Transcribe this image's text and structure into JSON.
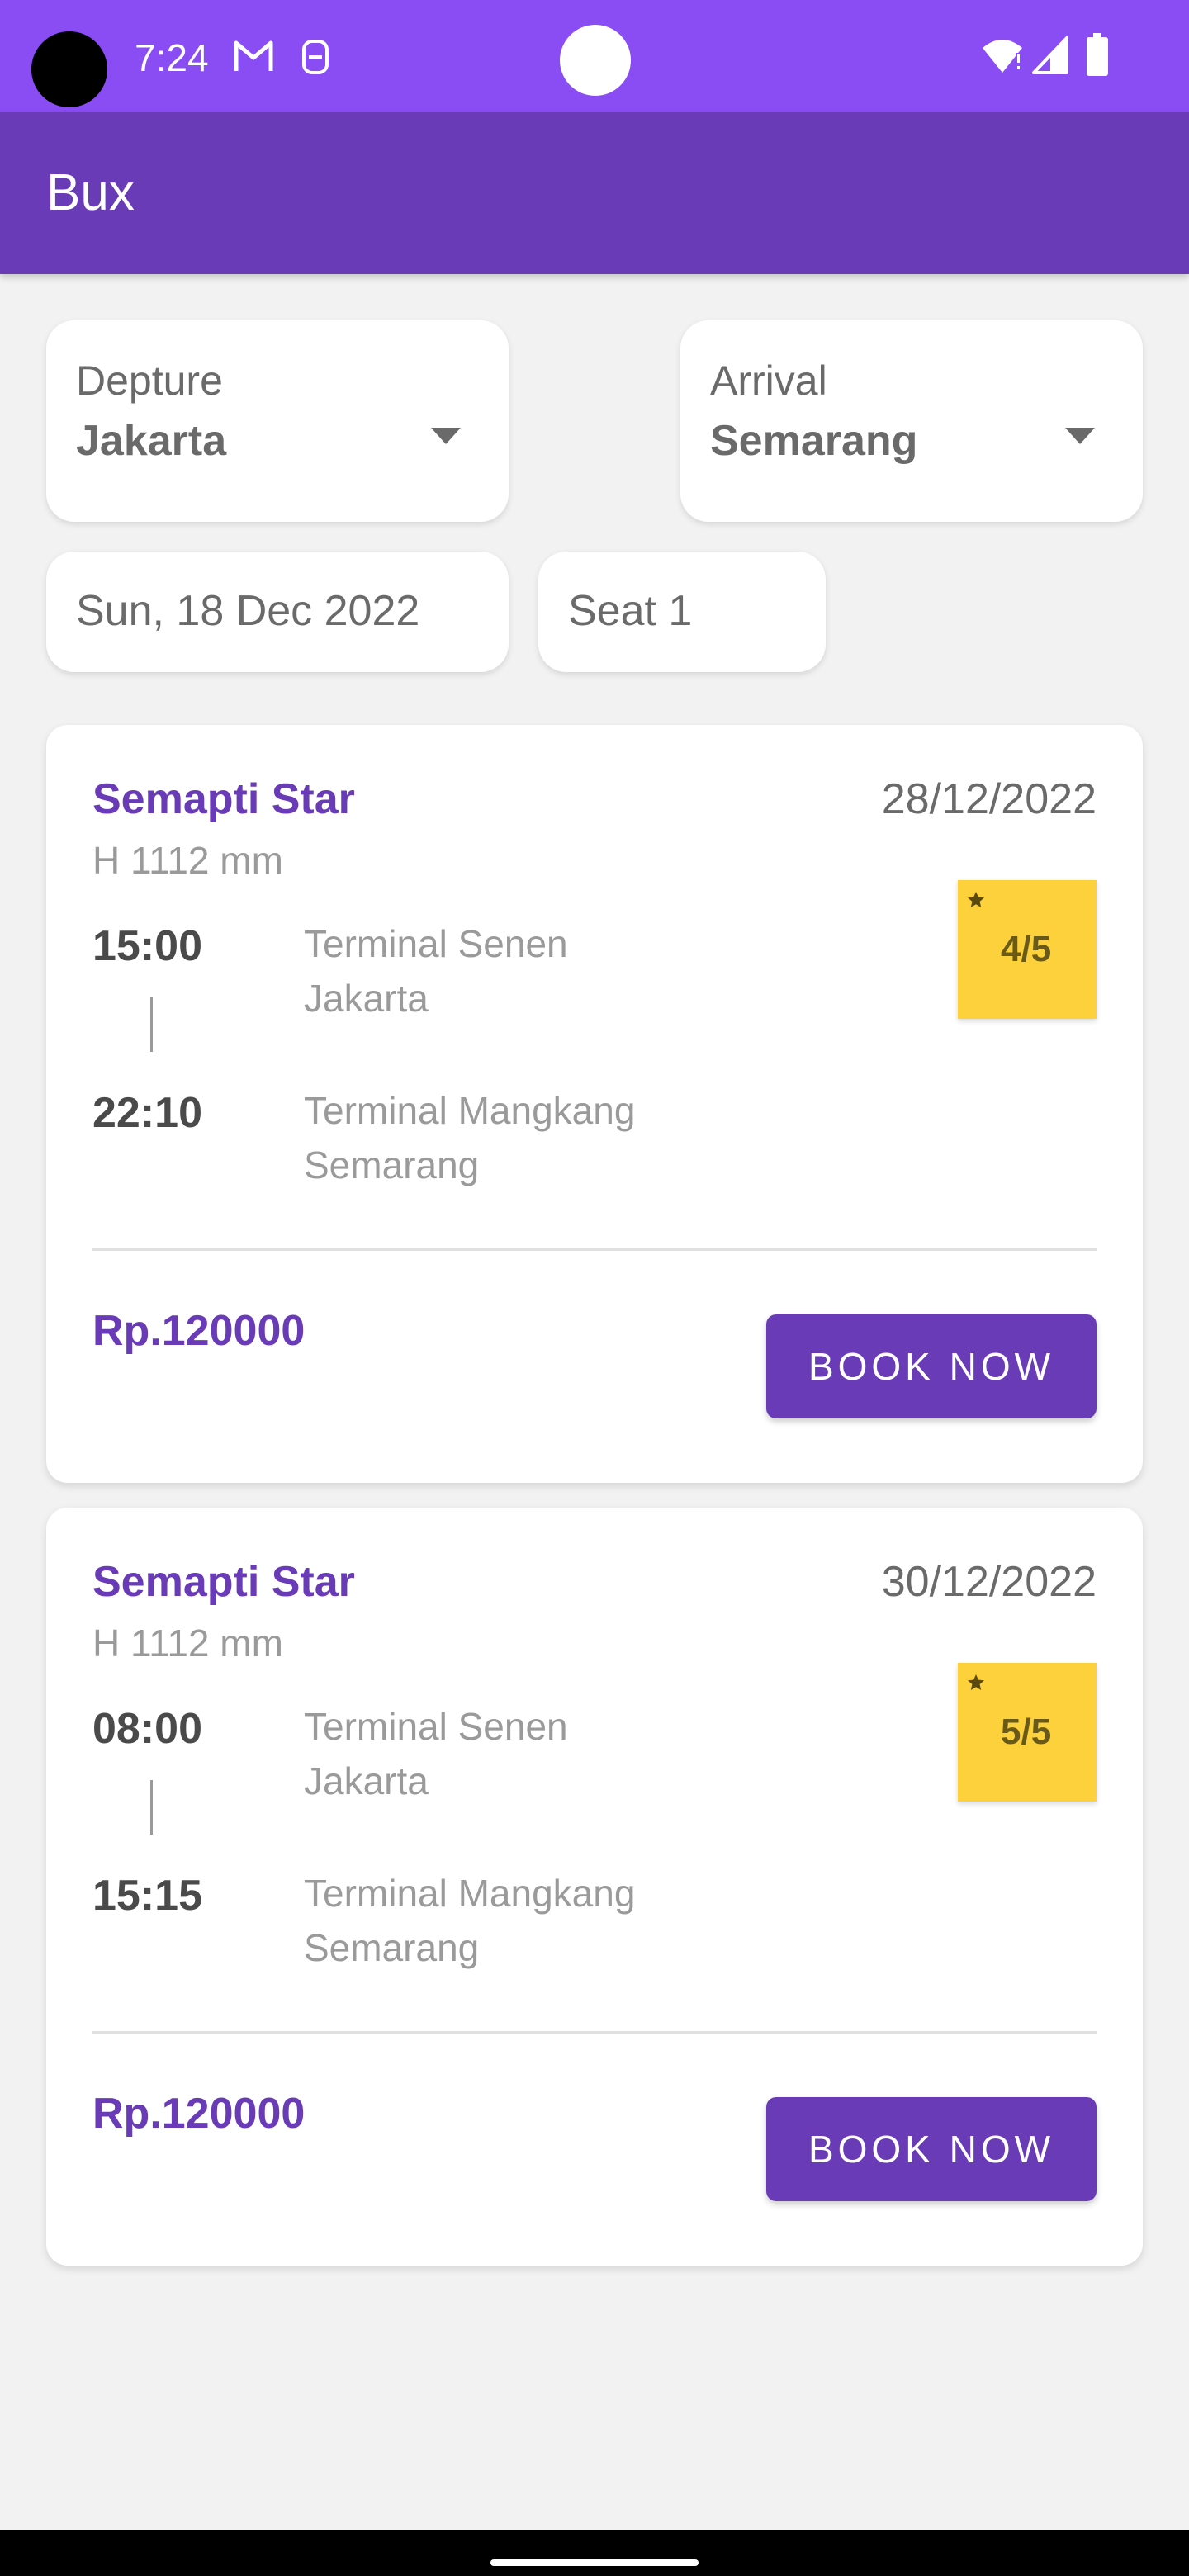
{
  "status_bar": {
    "time": "7:24",
    "icons": [
      "gmail-icon",
      "notification-icon",
      "wifi-icon",
      "signal-icon",
      "battery-icon"
    ]
  },
  "app_bar": {
    "title": "Bux"
  },
  "colors": {
    "primary": "#6a3bb7",
    "status_bar": "#8a4cf3",
    "rating_badge": "#fdd13b",
    "background": "#f2f2f2"
  },
  "search": {
    "departure_label": "Depture",
    "departure_value": "Jakarta",
    "arrival_label": "Arrival",
    "arrival_value": "Semarang",
    "date": "Sun, 18 Dec 2022",
    "seat": "Seat 1"
  },
  "trips": [
    {
      "bus_name": "Semapti Star",
      "height": "H 1112 mm",
      "date": "28/12/2022",
      "rating": "4/5",
      "depart_time": "15:00",
      "depart_terminal": "Terminal Senen",
      "depart_city": "Jakarta",
      "arrive_time": "22:10",
      "arrive_terminal": "Terminal Mangkang",
      "arrive_city": "Semarang",
      "price": "Rp.120000",
      "book_label": "BOOK NOW"
    },
    {
      "bus_name": "Semapti Star",
      "height": "H 1112 mm",
      "date": "30/12/2022",
      "rating": "5/5",
      "depart_time": "08:00",
      "depart_terminal": "Terminal Senen",
      "depart_city": "Jakarta",
      "arrive_time": "15:15",
      "arrive_terminal": "Terminal Mangkang",
      "arrive_city": "Semarang",
      "price": "Rp.120000",
      "book_label": "BOOK NOW"
    }
  ]
}
